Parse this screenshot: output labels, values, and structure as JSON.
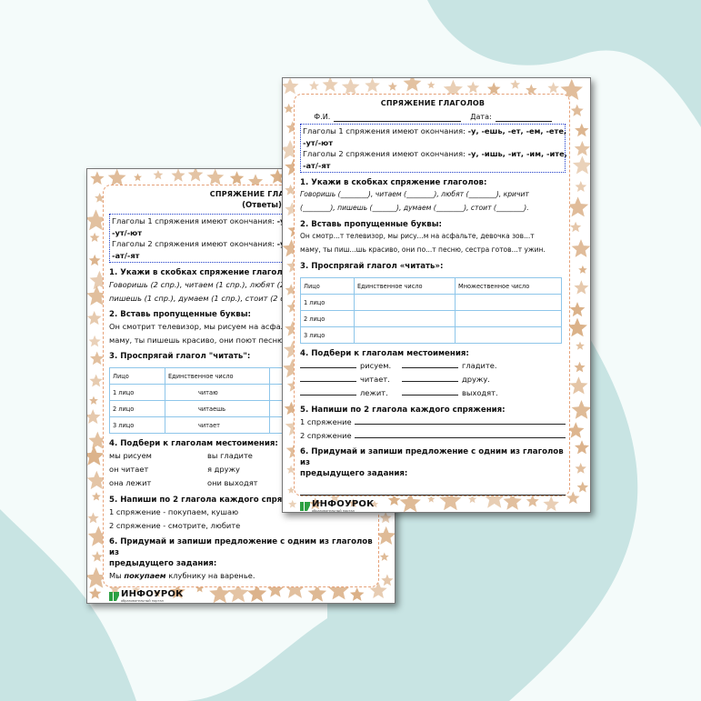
{
  "colors": {
    "background": "#c8e4e3",
    "blob": "#f4fbfa",
    "star": "#d9ad82",
    "frame": "#e6a178",
    "rule_border": "#1d3cc9",
    "table_border": "#8ec6ea",
    "logo_green": "#2ea043"
  },
  "back": {
    "title": "СПРЯЖЕНИЕ ГЛАГОЛОВ",
    "subtitle": "(Ответы)",
    "rule1_text": "Глаголы 1 спряжения имеют окончания:",
    "rule1_endings_a": "-у,",
    "rule1_endings_b": "-ут/-ют",
    "rule2_text": "Глаголы 2 спряжения имеют окончания:",
    "rule2_endings_a": "-у,",
    "rule2_endings_b": "-ат/-ят",
    "task1_title": "1. Укажи в скобках спряжение глаголов:",
    "task1_line1": "Говоришь (2 спр.), читаем (1 спр.), любят (2 сп",
    "task1_line2": "пишешь (1 спр.), думаем (1 спр.), стоит (2 спр",
    "task2_title": "2. Вставь пропущенные буквы:",
    "task2_line1": "Он смотрит телевизор, мы рисуем на асфальт",
    "task2_line2": "маму, ты пишешь красиво, они поют песню,",
    "task3_title": "3. Проспрягай глагол \"читать\":",
    "table_headers": [
      "Лицо",
      "Единственное число",
      ""
    ],
    "table_rows": [
      [
        "1 лицо",
        "читаю",
        ""
      ],
      [
        "2 лицо",
        "читаешь",
        ""
      ],
      [
        "3 лицо",
        "читает",
        ""
      ]
    ],
    "task4_title": "4. Подбери к глаголам местоимения:",
    "task4_rows": [
      [
        "мы рисуем",
        "вы гладите"
      ],
      [
        "он читает",
        "я дружу"
      ],
      [
        "она лежит",
        "они выходят"
      ]
    ],
    "task5_title": "5. Напиши по 2 глагола каждого спряжен",
    "task5_line1": "1 спряжение - покупаем, кушаю",
    "task5_line2": "2 спряжение - смотрите, любите",
    "task6_title_1": "6. Придумай и запиши предложение с одним из глаголов из",
    "task6_title_2": "предыдущего задания:",
    "task6_pre": "Мы",
    "task6_word": "покупаем",
    "task6_post": "клубнику на варенье.",
    "logo_name": "ИНФОУРОК",
    "logo_tag": "образовательный портал"
  },
  "front": {
    "title": "СПРЯЖЕНИЕ ГЛАГОЛОВ",
    "fio_label": "Ф.И.",
    "date_label": "Дата:",
    "rule1_text": "Глаголы 1 спряжения имеют окончания:",
    "rule1_endings_a": "-у, -ешь, -ет, -ем, -ете,",
    "rule1_endings_b": "-ут/-ют",
    "rule2_text": "Глаголы 2 спряжения имеют окончания:",
    "rule2_endings_a": "-у, -ишь, -ит, -им, -ите,",
    "rule2_endings_b": "-ат/-ят",
    "task1_title": "1. Укажи в скобках спряжение глаголов:",
    "task1_line1": "Говоришь (________), читаем (________), любят (________), кричит",
    "task1_line2": "(________), пишешь (_______), думаем (________), стоит (________).",
    "task2_title": "2. Вставь пропущенные буквы:",
    "task2_line1": "Он смотр...т телевизор, мы рису...м на асфальте, девочка зов...т",
    "task2_line2": "маму, ты пиш...шь красиво, они по...т песню, сестра готов...т ужин.",
    "task3_title": "3. Проспрягай глагол «читать»:",
    "table_headers": [
      "Лицо",
      "Единственное число",
      "Множественное число"
    ],
    "table_rows": [
      [
        "1 лицо",
        "",
        ""
      ],
      [
        "2 лицо",
        "",
        ""
      ],
      [
        "3 лицо",
        "",
        ""
      ]
    ],
    "task4_title": "4. Подбери к глаголам местоимения:",
    "task4_rows": [
      [
        "рисуем.",
        "гладите."
      ],
      [
        "читает.",
        "дружу."
      ],
      [
        "лежит.",
        "выходят."
      ]
    ],
    "task5_title": "5. Напиши по 2 глагола каждого спряжения:",
    "task5_line1": "1 спряжение",
    "task5_line2": "2 спряжение",
    "task6_title_1": "6. Придумай и запиши предложение с одним из глаголов из",
    "task6_title_2": "предыдущего задания:",
    "logo_name": "ИНФОУРОК",
    "logo_tag": "образовательный портал"
  }
}
